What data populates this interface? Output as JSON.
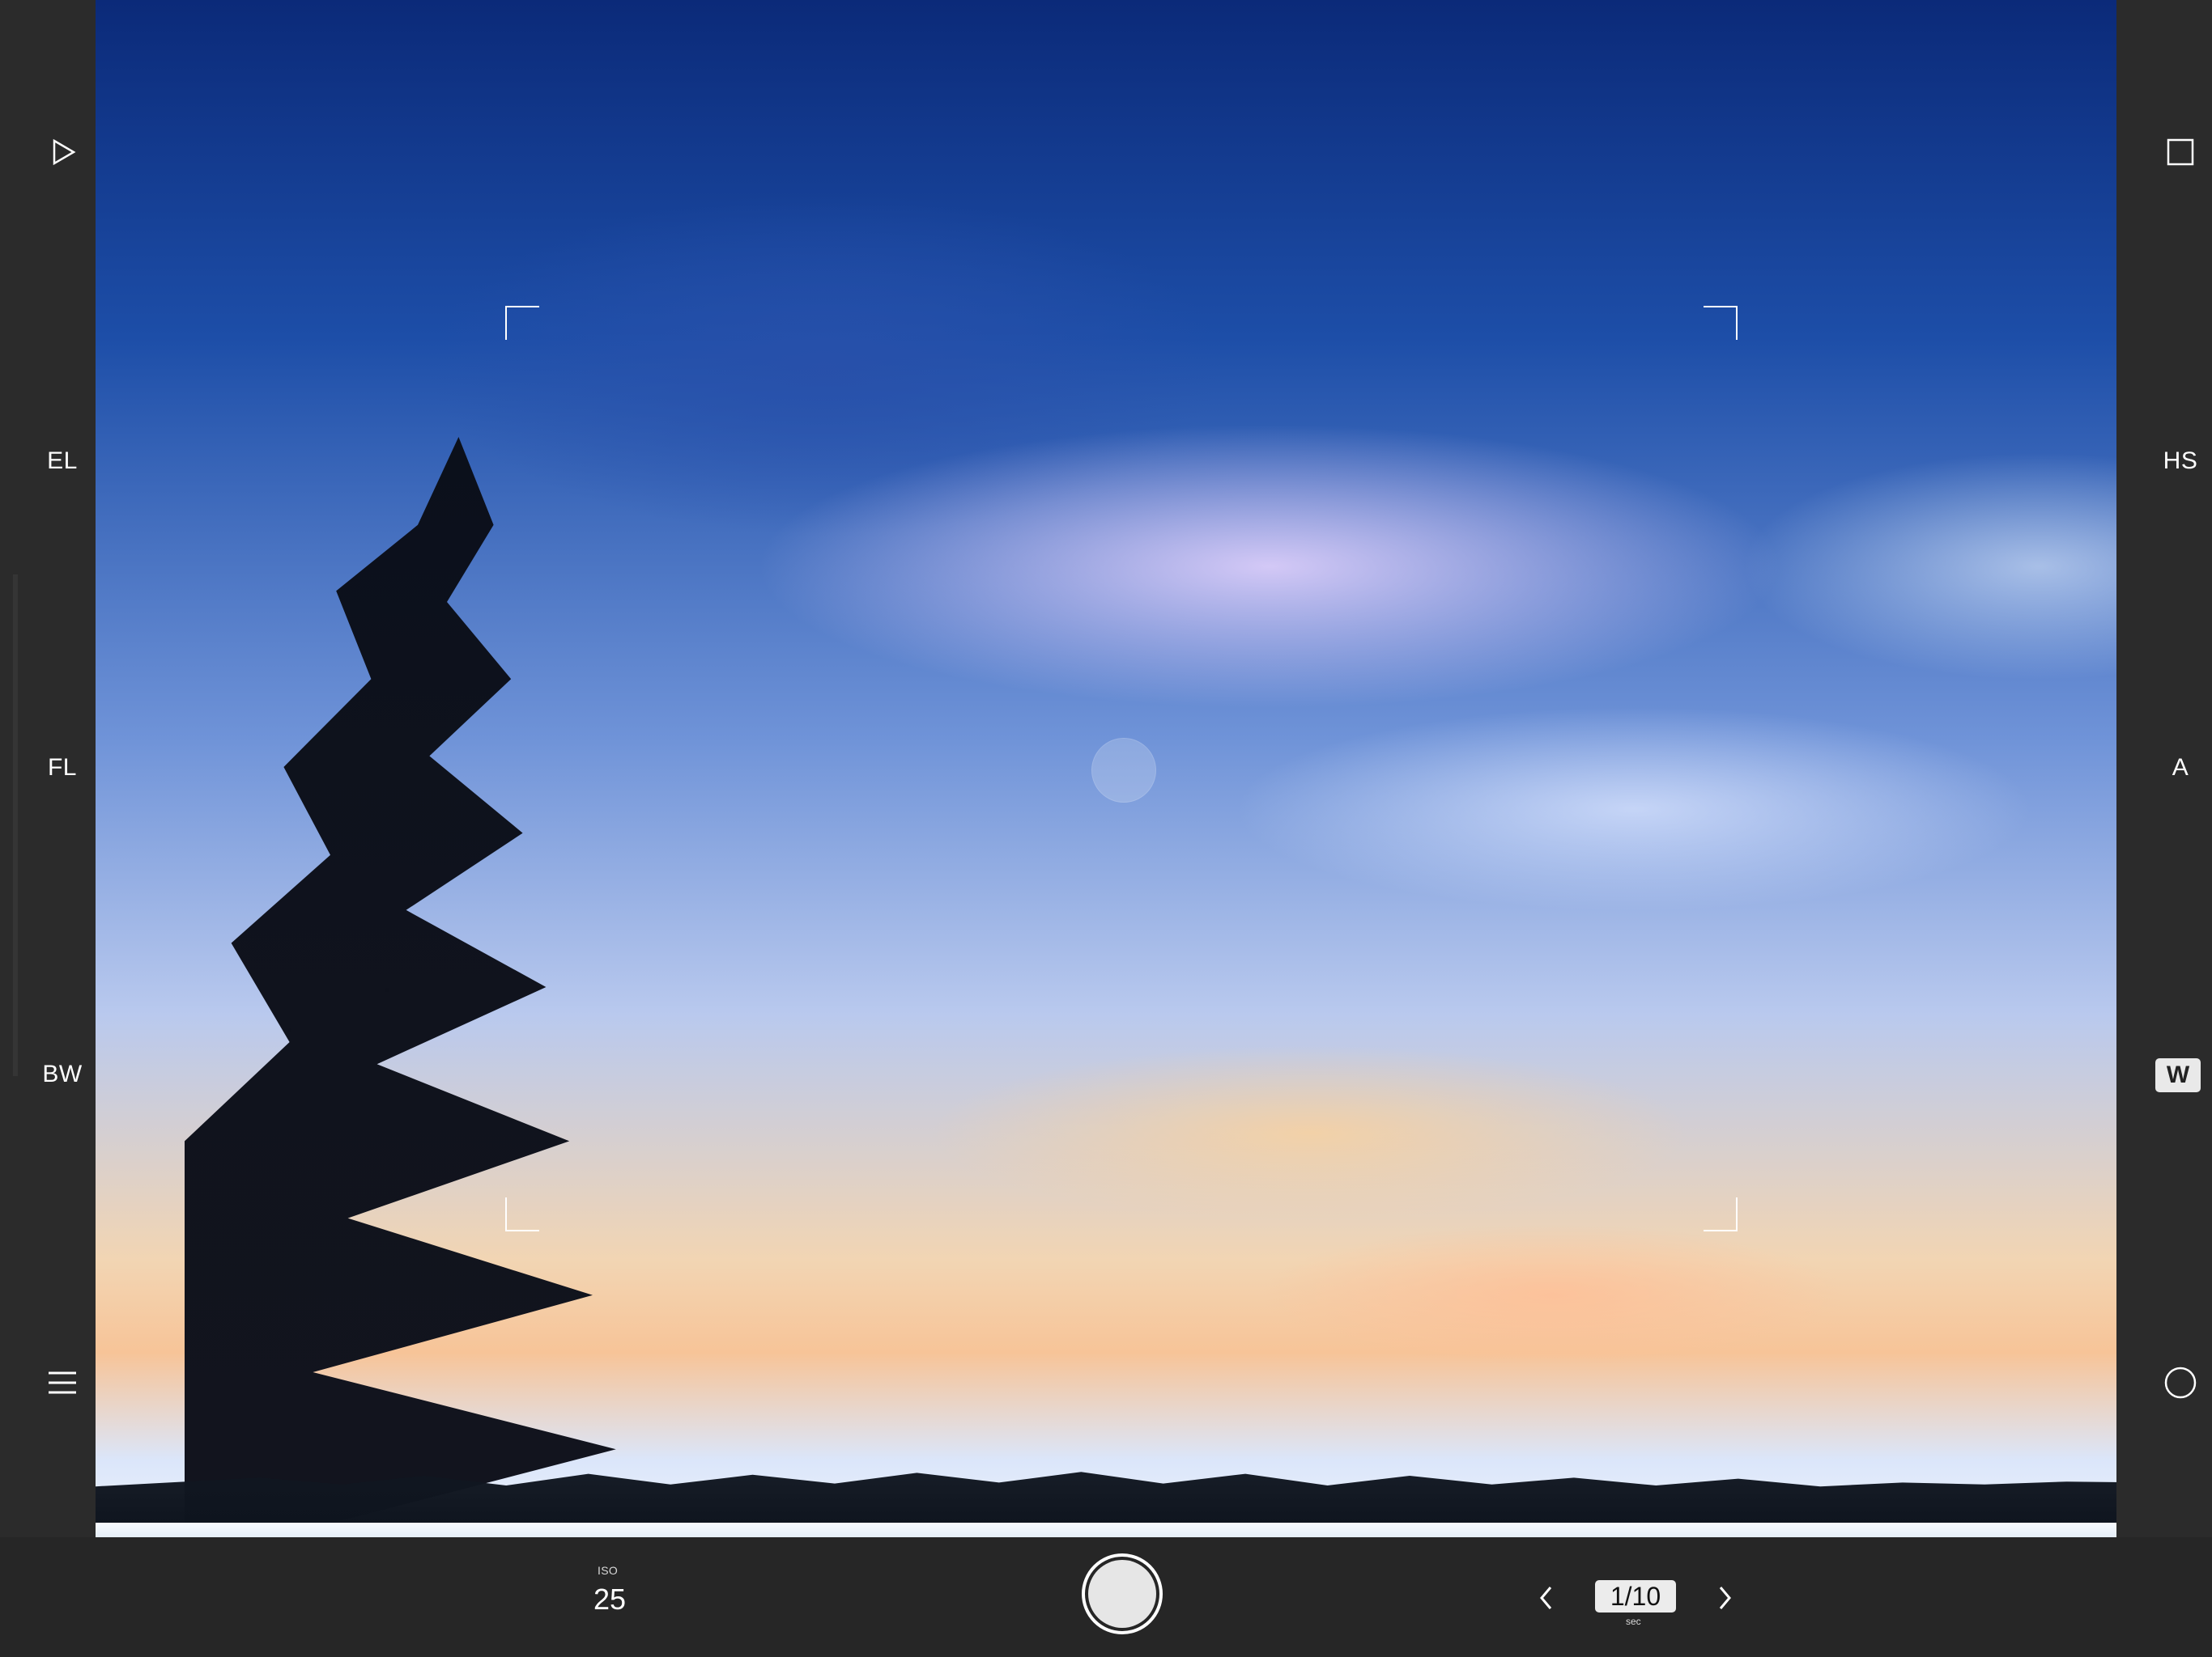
{
  "left_sidebar": {
    "play_icon": "play-icon",
    "el_label": "EL",
    "fl_label": "FL",
    "bw_label": "BW",
    "menu_icon": "menu-icon"
  },
  "right_sidebar": {
    "frame_icon": "square-icon",
    "hs_label": "HS",
    "a_label": "A",
    "w_label": "W",
    "circle_icon": "circle-icon"
  },
  "bottom_controls": {
    "iso_label": "ISO",
    "iso_value": "25",
    "shutter_speed": "1/10",
    "shutter_unit": "sec",
    "prev_icon": "chevron-left-icon",
    "next_icon": "chevron-right-icon",
    "shutter_button_icon": "shutter-icon"
  },
  "viewfinder": {
    "focus_indicator": "focus-point"
  },
  "colors": {
    "panel": "#2b2b2b",
    "bottom_bar": "#262626",
    "chip_bg": "#ececec",
    "chip_text": "#111111"
  }
}
